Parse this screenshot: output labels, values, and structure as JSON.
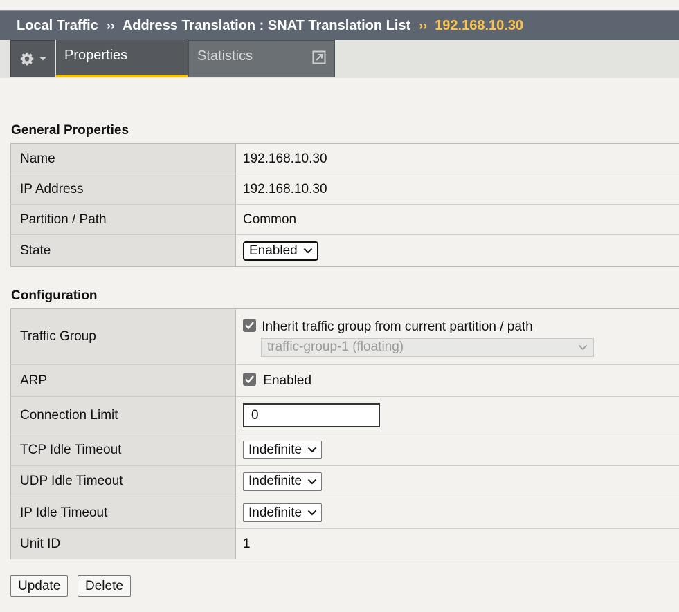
{
  "breadcrumb": {
    "items": [
      "Local Traffic",
      "Address Translation : SNAT Translation List"
    ],
    "separator": "››",
    "current": "192.168.10.30"
  },
  "tabs": {
    "gear_icon": "gear-icon",
    "properties": "Properties",
    "statistics": "Statistics"
  },
  "general": {
    "title": "General Properties",
    "name_label": "Name",
    "name_value": "192.168.10.30",
    "ip_label": "IP Address",
    "ip_value": "192.168.10.30",
    "partition_label": "Partition / Path",
    "partition_value": "Common",
    "state_label": "State",
    "state_value": "Enabled"
  },
  "configuration": {
    "title": "Configuration",
    "traffic_group_label": "Traffic Group",
    "traffic_group_inherit_label": "Inherit traffic group from current partition / path",
    "traffic_group_inherit_checked": true,
    "traffic_group_value": "traffic-group-1 (floating)",
    "arp_label": "ARP",
    "arp_checkbox_label": "Enabled",
    "arp_checked": true,
    "connection_limit_label": "Connection Limit",
    "connection_limit_value": "0",
    "tcp_label": "TCP Idle Timeout",
    "tcp_value": "Indefinite",
    "udp_label": "UDP Idle Timeout",
    "udp_value": "Indefinite",
    "ip_idle_label": "IP Idle Timeout",
    "ip_idle_value": "Indefinite",
    "unit_id_label": "Unit ID",
    "unit_id_value": "1"
  },
  "actions": {
    "update": "Update",
    "delete": "Delete"
  },
  "colors": {
    "header_bg": "#5d6670",
    "accent": "#fdc24a",
    "tab_active_underline": "#f5c400"
  }
}
